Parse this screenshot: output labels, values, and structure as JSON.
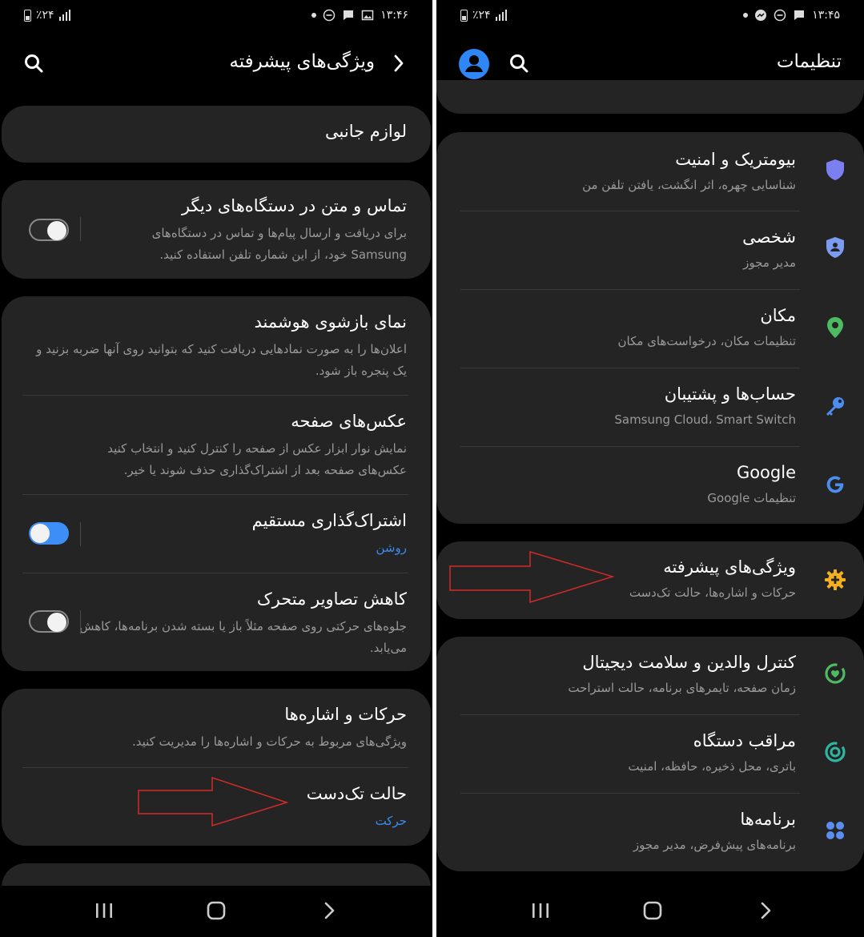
{
  "left_screen": {
    "status": {
      "time": "۱۳:۴۶",
      "battery": "٪۲۴"
    },
    "header": {
      "title": "ویژگی‌های پیشرفته"
    },
    "cards": [
      {
        "rows": [
          {
            "title": "لوازم جانبی"
          }
        ]
      },
      {
        "rows": [
          {
            "title": "تماس و متن در دستگاه‌های دیگر",
            "sub": "برای دریافت و ارسال پیام‌ها و تماس در دستگاه‌های Samsung خود، از این شماره تلفن استفاده کنید.",
            "toggle": "off"
          }
        ]
      },
      {
        "rows": [
          {
            "title": "نمای بازشوی هوشمند",
            "sub": "اعلان‌ها را به صورت نمادهایی دریافت کنید که بتوانید روی آنها ضربه بزنید و یک پنجره باز شود."
          },
          {
            "title": "عکس‌های صفحه",
            "sub": "نمایش نوار ابزار عکس از صفحه را کنترل کنید و انتخاب کنید عکس‌های صفحه بعد از اشتراک‌گذاری حذف شوند یا خیر."
          },
          {
            "title": "اشتراک‌گذاری مستقیم",
            "sub": "روشن",
            "toggle": "on"
          },
          {
            "title": "کاهش تصاویر متحرک",
            "sub": "جلوه‌های حرکتی روی صفحه مثلاً باز یا بسته شدن برنامه‌ها، کاهش می‌یابد.",
            "toggle": "off"
          }
        ]
      },
      {
        "rows": [
          {
            "title": "حرکات و اشاره‌ها",
            "sub": "ویژگی‌های مربوط به حرکات و اشاره‌ها را مدیریت کنید."
          },
          {
            "title": "حالت تک‌دست",
            "sub": "حرکت"
          }
        ]
      }
    ]
  },
  "right_screen": {
    "status": {
      "time": "۱۳:۴۵",
      "battery": "٪۲۴"
    },
    "header": {
      "title": "تنظیمات"
    },
    "cards": [
      {
        "rows": [
          {
            "title": "بیومتریک و امنیت",
            "sub": "شناسایی چهره، اثر انگشت، یافتن تلفن من",
            "icon": "shield-icon",
            "color": "#7b7ff0"
          },
          {
            "title": "شخصی",
            "sub": "مدیر مجوز",
            "icon": "privacy-shield-icon",
            "color": "#7b9cf0"
          },
          {
            "title": "مکان",
            "sub": "تنظیمات مکان، درخواست‌های مکان",
            "icon": "location-pin-icon",
            "color": "#4cbb62"
          },
          {
            "title": "حساب‌ها و پشتیبان",
            "sub": "Samsung Cloud، Smart Switch",
            "icon": "key-icon",
            "color": "#4c8ef0"
          },
          {
            "title": "Google",
            "sub": "تنظیمات Google",
            "icon": "google-icon",
            "color": "#4c8ef0"
          }
        ]
      },
      {
        "rows": [
          {
            "title": "ویژگی‌های پیشرفته",
            "sub": "حرکات و اشاره‌ها، حالت تک‌دست",
            "icon": "advanced-features-icon",
            "color": "#f5b020"
          }
        ]
      },
      {
        "rows": [
          {
            "title": "کنترل والدین و سلامت دیجیتال",
            "sub": "زمان صفحه، تایمرهای برنامه، حالت استراحت",
            "icon": "digital-wellbeing-icon",
            "color": "#4cbb62"
          },
          {
            "title": "مراقب دستگاه",
            "sub": "باتری، محل ذخیره، حافظه، امنیت",
            "icon": "device-care-icon",
            "color": "#2fb5a0"
          },
          {
            "title": "برنامه‌ها",
            "sub": "برنامه‌های پیش‌فرض، مدیر مجوز",
            "icon": "apps-icon",
            "color": "#5b8ef0"
          }
        ]
      }
    ]
  },
  "colors": {
    "card": "#242424",
    "accent": "#3e8ef7",
    "annotation": "#d42a2a"
  }
}
